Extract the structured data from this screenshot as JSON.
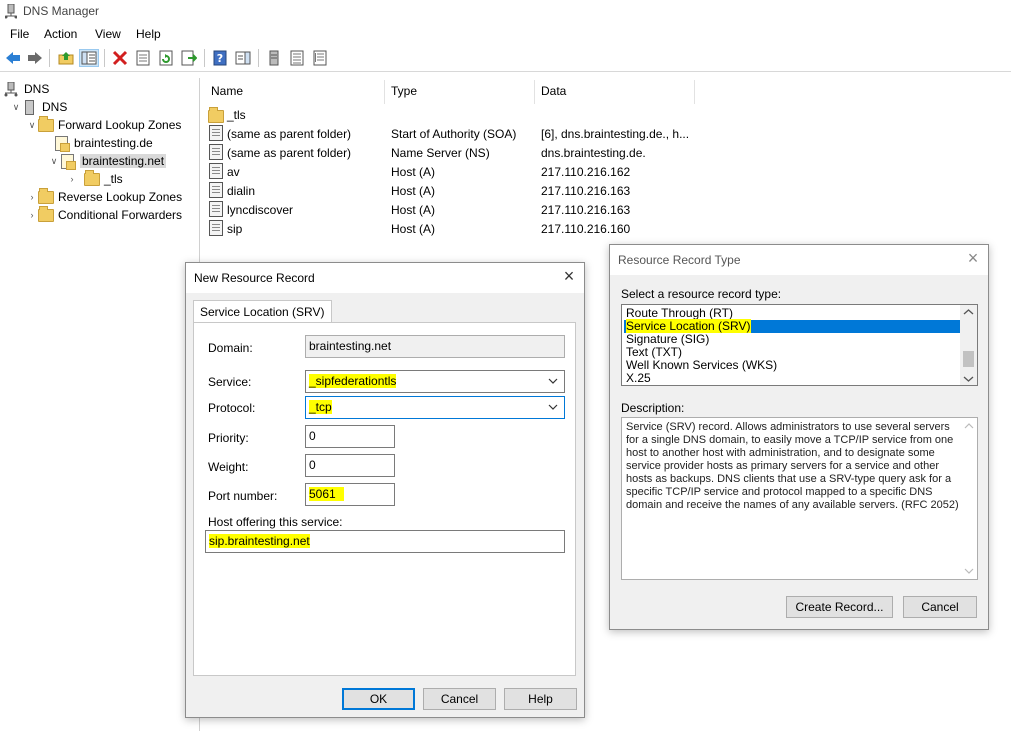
{
  "window": {
    "title": "DNS Manager"
  },
  "menu": {
    "file": "File",
    "action": "Action",
    "view": "View",
    "help": "Help"
  },
  "toolbar_icons": [
    "back-arrow-icon",
    "forward-arrow-icon",
    "up-folder-icon",
    "show-hide-tree-icon",
    "delete-icon",
    "properties-icon",
    "refresh-icon",
    "export-list-icon",
    "help-icon",
    "action-pane-icon",
    "new-server-icon",
    "list-view-icon",
    "detail-view-icon"
  ],
  "tree": {
    "root": "DNS",
    "server": "DNS",
    "forward": "Forward Lookup Zones",
    "zone1": "braintesting.de",
    "zone2": "braintesting.net",
    "tls": "_tls",
    "reverse": "Reverse Lookup Zones",
    "conditional": "Conditional Forwarders"
  },
  "list": {
    "headers": {
      "name": "Name",
      "type": "Type",
      "data": "Data"
    },
    "rows": [
      {
        "name": "_tls",
        "type": "",
        "data": "",
        "icon": "folder-icon"
      },
      {
        "name": "(same as parent folder)",
        "type": "Start of Authority (SOA)",
        "data": "[6], dns.braintesting.de., h...",
        "icon": "record-icon"
      },
      {
        "name": "(same as parent folder)",
        "type": "Name Server (NS)",
        "data": "dns.braintesting.de.",
        "icon": "record-icon"
      },
      {
        "name": "av",
        "type": "Host (A)",
        "data": "217.110.216.162",
        "icon": "record-icon"
      },
      {
        "name": "dialin",
        "type": "Host (A)",
        "data": "217.110.216.163",
        "icon": "record-icon"
      },
      {
        "name": "lyncdiscover",
        "type": "Host (A)",
        "data": "217.110.216.163",
        "icon": "record-icon"
      },
      {
        "name": "sip",
        "type": "Host (A)",
        "data": "217.110.216.160",
        "icon": "record-icon"
      }
    ]
  },
  "new_record": {
    "title": "New Resource Record",
    "tab": "Service Location (SRV)",
    "domain_label": "Domain:",
    "domain_value": "braintesting.net",
    "service_label": "Service:",
    "service_value": "_sipfederationtls",
    "protocol_label": "Protocol:",
    "protocol_value": "_tcp",
    "priority_label": "Priority:",
    "priority_value": "0",
    "weight_label": "Weight:",
    "weight_value": "0",
    "port_label": "Port number:",
    "port_value": "5061",
    "host_label": "Host offering this service:",
    "host_value": "sip.braintesting.net",
    "ok": "OK",
    "cancel": "Cancel",
    "help": "Help",
    "highlight_color": "#ffff00"
  },
  "record_type": {
    "title": "Resource Record Type",
    "select_label": "Select a resource record type:",
    "items": [
      "Route Through (RT)",
      "Service Location (SRV)",
      "Signature (SIG)",
      "Text (TXT)",
      "Well Known Services (WKS)",
      "X.25"
    ],
    "selected": "Service Location (SRV)",
    "description_label": "Description:",
    "description": "Service (SRV) record. Allows administrators to use several servers for a single DNS domain, to easily move a TCP/IP service from one host to another host with administration, and to designate some service provider hosts as primary servers for a service and other hosts as backups. DNS clients that use a SRV-type query ask for a specific TCP/IP service and protocol mapped to a specific DNS domain and receive the names of any available servers. (RFC 2052)",
    "create": "Create Record...",
    "cancel": "Cancel",
    "selection_color": "#0078d7"
  }
}
